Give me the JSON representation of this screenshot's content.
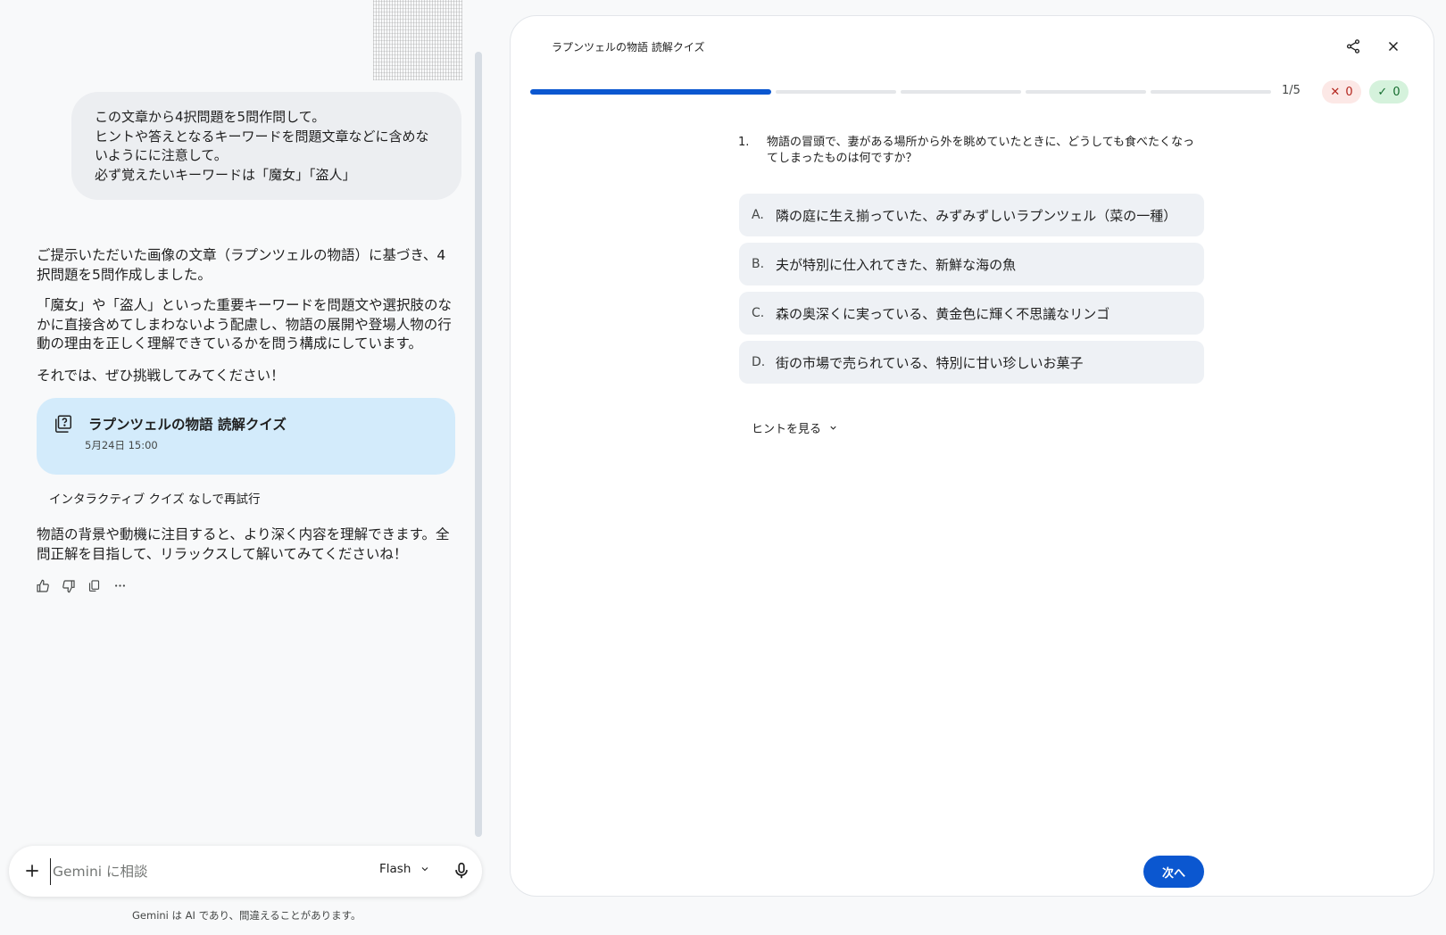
{
  "chat": {
    "user_message": [
      "この文章から4択問題を5問作問して。",
      "ヒントや答えとなるキーワードを問題文章などに含めな",
      "いようにに注意して。",
      "必ず覚えたいキーワードは「魔女」「盗人」"
    ],
    "response": {
      "paragraph_1": "ご提示いただいた画像の文章（ラプンツェルの物語）に基づき、4択問題を5問作成しました。",
      "paragraph_2": "「魔女」や「盗人」といった重要キーワードを問題文や選択肢のなかに直接含めてしまわないよう配慮し、物語の展開や登場人物の行動の理由を正しく理解できているかを問う構成にしています。",
      "paragraph_3": "それでは、ぜひ挑戦してみてください！",
      "paragraph_4": "物語の背景や動機に注目すると、より深く内容を理解できます。全問正解を目指して、リラックスして解いてみてくださいね！"
    },
    "quiz_card": {
      "title": "ラプンツェルの物語 読解クイズ",
      "date": "5月24日 15:00"
    },
    "retry_label": "インタラクティブ クイズ なしで再試行",
    "actions": [
      "thumb-up-icon",
      "thumb-down-icon",
      "copy-icon",
      "more-icon"
    ],
    "composer": {
      "placeholder": "Gemini に相談",
      "model": "Flash"
    },
    "disclaimer": "Gemini は AI であり、間違えることがあります。"
  },
  "quiz": {
    "title": "ラプンツェルの物語 読解クイズ",
    "progress": {
      "current": 1,
      "total": 5
    },
    "counter": "1/5",
    "wrong_count": "0",
    "right_count": "0",
    "question_number": "1.",
    "question_text": "物語の冒頭で、妻がある場所から外を眺めていたときに、どうしても食べたくなってしまったものは何ですか？",
    "options": [
      {
        "letter": "A.",
        "text": "隣の庭に生え揃っていた、みずみずしいラプンツェル（菜の一種）"
      },
      {
        "letter": "B.",
        "text": "夫が特別に仕入れてきた、新鮮な海の魚"
      },
      {
        "letter": "C.",
        "text": "森の奥深くに実っている、黄金色に輝く不思議なリンゴ"
      },
      {
        "letter": "D.",
        "text": "街の市場で売られている、特別に甘い珍しいお菓子"
      }
    ],
    "hint_label": "ヒントを見る",
    "next_label": "次へ"
  },
  "colors": {
    "accent": "#0b57d0",
    "card_bg": "#d3ebfb",
    "wrong_bg": "#fce8e6",
    "right_bg": "#d5f2dc"
  }
}
